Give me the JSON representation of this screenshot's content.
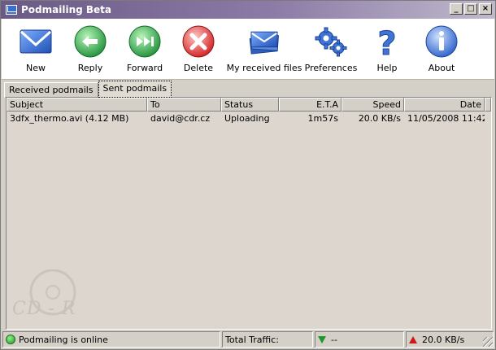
{
  "window": {
    "title": "Podmailing Beta"
  },
  "toolbar": {
    "buttons": [
      {
        "label": "New",
        "icon": "envelope-icon"
      },
      {
        "label": "Reply",
        "icon": "reply-arrow-icon"
      },
      {
        "label": "Forward",
        "icon": "forward-arrows-icon"
      },
      {
        "label": "Delete",
        "icon": "delete-x-icon"
      },
      {
        "label": "My received files",
        "icon": "stacked-envelopes-icon"
      },
      {
        "label": "Preferences",
        "icon": "gears-icon"
      },
      {
        "label": "Help",
        "icon": "question-mark-icon"
      },
      {
        "label": "About",
        "icon": "info-icon"
      }
    ]
  },
  "tabs": [
    {
      "label": "Received podmails",
      "active": false
    },
    {
      "label": "Sent podmails",
      "active": true
    }
  ],
  "table": {
    "columns": [
      "Subject",
      "To",
      "Status",
      "E.T.A",
      "Speed",
      "Date"
    ],
    "rows": [
      {
        "subject": "3dfx_thermo.avi (4.12 MB)",
        "to": "david@cdr.cz",
        "status": "Uploading",
        "eta": "1m57s",
        "speed": "20.0 KB/s",
        "date": "11/05/2008 11:42"
      }
    ]
  },
  "watermark": {
    "text": "CD - R"
  },
  "statusbar": {
    "online": "Podmailing is online",
    "traffic_label": "Total Traffic:",
    "download": "--",
    "upload": "20.0 KB/s"
  },
  "colors": {
    "titlebar": "#6b5a86",
    "accent_blue": "#3a6fd0",
    "green": "#1b9a1b",
    "red": "#d01818"
  }
}
